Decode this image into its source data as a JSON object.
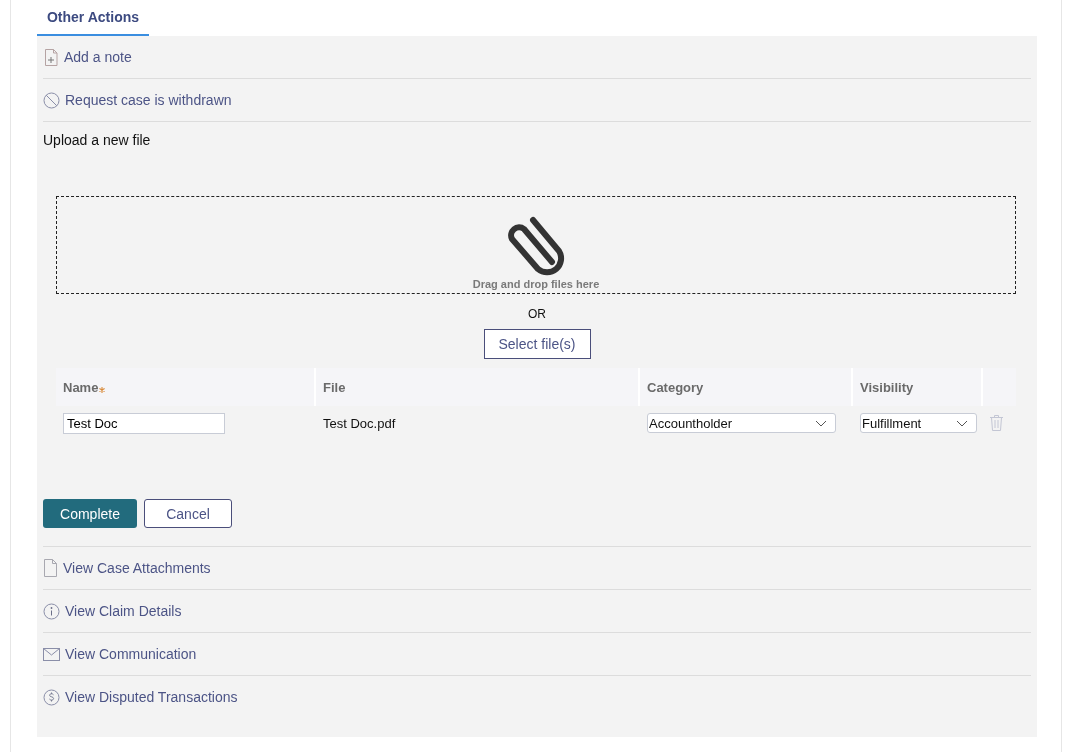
{
  "tab": {
    "label": "Other Actions",
    "selected": true
  },
  "actions_top": [
    {
      "kind": "note",
      "label": "Add a note"
    },
    {
      "kind": "withdraw",
      "label": "Request case is withdrawn"
    }
  ],
  "upload": {
    "title": "Upload a new file",
    "dropzone_text": "Drag and drop files here",
    "or_text": "OR",
    "select_button": "Select file(s)",
    "columns": [
      {
        "label": "Name",
        "required": true
      },
      {
        "label": "File",
        "required": false
      },
      {
        "label": "Category",
        "required": false
      },
      {
        "label": "Visibility",
        "required": false
      }
    ],
    "rows": [
      {
        "name": "Test Doc",
        "file": "Test Doc.pdf",
        "category": "Accountholder",
        "visibility": "Fulfillment"
      }
    ],
    "buttons": [
      {
        "kind": "primary",
        "label": "Complete"
      },
      {
        "kind": "secondary",
        "label": "Cancel"
      }
    ]
  },
  "actions_bottom": [
    {
      "kind": "document",
      "label": "View Case Attachments"
    },
    {
      "kind": "info",
      "label": "View Claim Details"
    },
    {
      "kind": "mail",
      "label": "View Communication"
    },
    {
      "kind": "dollar",
      "label": "View Disputed Transactions"
    }
  ]
}
